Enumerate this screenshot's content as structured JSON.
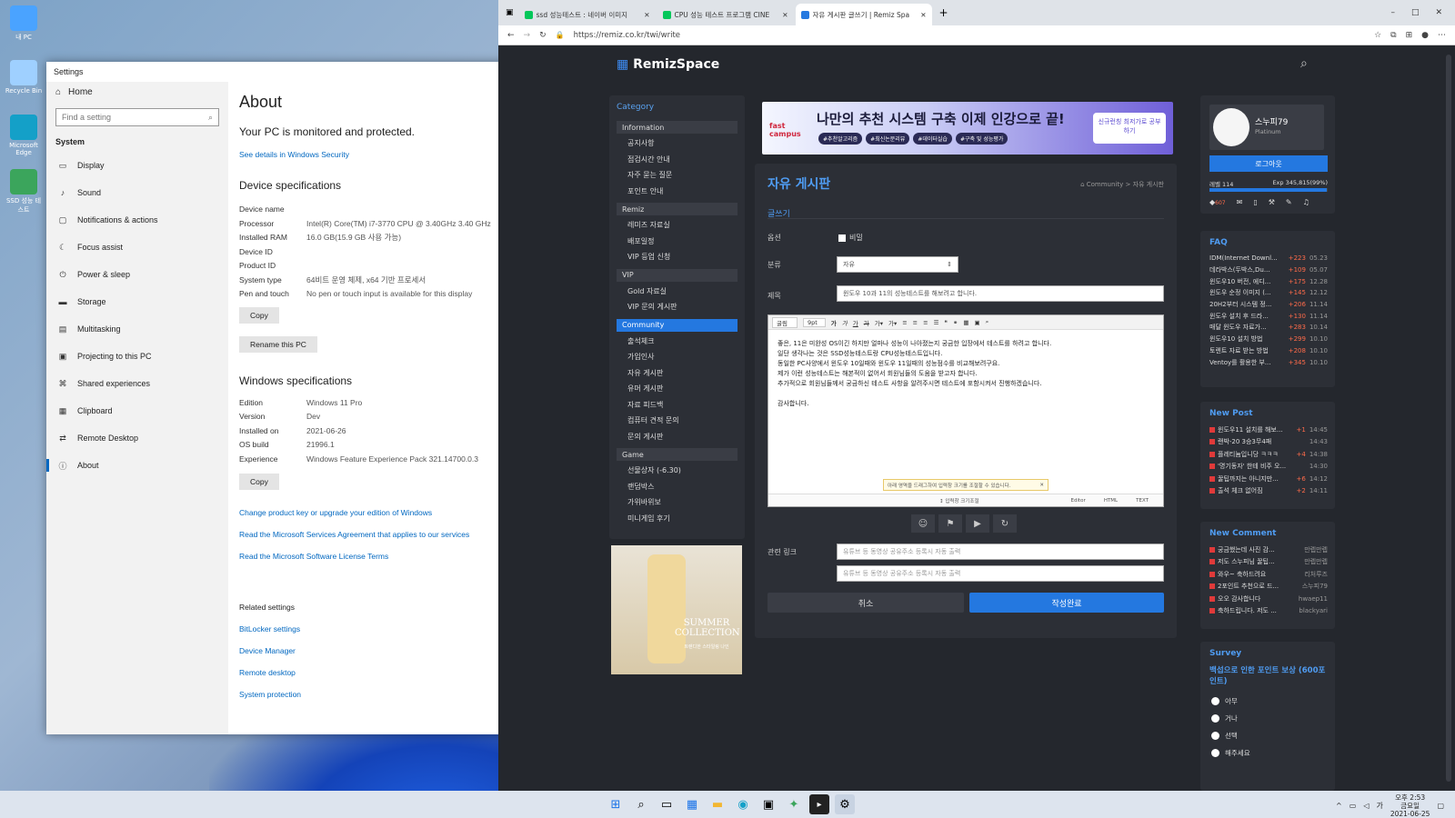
{
  "desktop": {
    "icons": [
      {
        "label": "내 PC",
        "color": "#4aa3ff"
      },
      {
        "label": "Recycle Bin",
        "color": "#9fd0ff"
      },
      {
        "label": "Microsoft Edge",
        "color": "#14a0c8"
      },
      {
        "label": "SSD 성능 테스트",
        "color": "#3ba55c"
      }
    ]
  },
  "settings": {
    "window_title": "Settings",
    "home": "Home",
    "search_placeholder": "Find a setting",
    "section": "System",
    "nav": [
      {
        "label": "Display",
        "icon": "▭"
      },
      {
        "label": "Sound",
        "icon": "♪"
      },
      {
        "label": "Notifications & actions",
        "icon": "▢"
      },
      {
        "label": "Focus assist",
        "icon": "☾"
      },
      {
        "label": "Power & sleep",
        "icon": "⏻"
      },
      {
        "label": "Storage",
        "icon": "▬"
      },
      {
        "label": "Multitasking",
        "icon": "▤"
      },
      {
        "label": "Projecting to this PC",
        "icon": "▣"
      },
      {
        "label": "Shared experiences",
        "icon": "⌘"
      },
      {
        "label": "Clipboard",
        "icon": "▦"
      },
      {
        "label": "Remote Desktop",
        "icon": "⇄"
      },
      {
        "label": "About",
        "icon": "ⓘ"
      }
    ],
    "about_title": "About",
    "protected": "Your PC is monitored and protected.",
    "security_link": "See details in Windows Security",
    "device_heading": "Device specifications",
    "device": [
      {
        "k": "Device name",
        "v": ""
      },
      {
        "k": "Processor",
        "v": "Intel(R) Core(TM) i7-3770 CPU @ 3.40GHz   3.40 GHz"
      },
      {
        "k": "Installed RAM",
        "v": "16.0 GB(15.9 GB 사용 가능)"
      },
      {
        "k": "Device ID",
        "v": ""
      },
      {
        "k": "Product ID",
        "v": ""
      },
      {
        "k": "System type",
        "v": "64비트 운영 체제, x64 기반 프로세서"
      },
      {
        "k": "Pen and touch",
        "v": "No pen or touch input is available for this display"
      }
    ],
    "copy_label": "Copy",
    "rename_label": "Rename this PC",
    "windows_heading": "Windows specifications",
    "windows": [
      {
        "k": "Edition",
        "v": "Windows 11 Pro"
      },
      {
        "k": "Version",
        "v": "Dev"
      },
      {
        "k": "Installed on",
        "v": "2021-06-26"
      },
      {
        "k": "OS build",
        "v": "21996.1"
      },
      {
        "k": "Experience",
        "v": "Windows Feature Experience Pack 321.14700.0.3"
      }
    ],
    "links": [
      "Change product key or upgrade your edition of Windows",
      "Read the Microsoft Services Agreement that applies to our services",
      "Read the Microsoft Software License Terms"
    ],
    "related_heading": "Related settings",
    "related": [
      "BitLocker settings",
      "Device Manager",
      "Remote desktop",
      "System protection"
    ]
  },
  "browser": {
    "tabs": [
      {
        "title": "ssd 성능테스트 : 네이버 이미지",
        "color": "#03c75a"
      },
      {
        "title": "CPU 성능 테스트 프로그램 CINE",
        "color": "#03c75a"
      },
      {
        "title": "자유 게시판 글쓰기 | Remiz Spa",
        "color": "#2478e0"
      }
    ],
    "url": "https://remiz.co.kr/twi/write"
  },
  "site": {
    "logo": "RemizSpace",
    "category_title": "Category",
    "sections": [
      {
        "title": "Information",
        "items": [
          "공지사항",
          "점검시간 안내",
          "자주 묻는 질문",
          "포인트 안내"
        ]
      },
      {
        "title": "Remiz",
        "items": [
          "레미즈 자료실",
          "배포일정",
          "VIP 등업 신청"
        ]
      },
      {
        "title": "VIP",
        "items": [
          "Gold 자료실",
          "VIP 문의 게시판"
        ]
      },
      {
        "title": "Community",
        "items": [
          "출석체크",
          "가입인사",
          "자유 게시판",
          "유머 게시판",
          "자료 피드백",
          "컴퓨터 견적 문의",
          "문의 게시판"
        ]
      },
      {
        "title": "Game",
        "items": [
          "선물상자 (-6.30)",
          "랜덤박스",
          "가위바위보",
          "미니게임 후기"
        ]
      }
    ],
    "ad_text": "나만의 추천 시스템 구축 이제 인강으로 끝!",
    "ad_brand": "fast campus",
    "ad_tags": [
      "#추천알고리즘",
      "#최신논문리뷰",
      "#데이터실습",
      "#구축 및 성능평가"
    ],
    "ad_cta": "신규런칭 최저가로 공부하기",
    "ad2_text": "SUMMER COLLECTION",
    "ad2_sub": "트렌디한 스타일링 나인",
    "board_title": "자유 게시판",
    "breadcrumb": "Community > 자유 게시판",
    "write_label": "글쓰기",
    "option_label": "옵션",
    "secret_label": "비밀",
    "category_label": "분류",
    "category_value": "자유",
    "subject_label": "제목",
    "subject_value": "윈도우 10과 11의 성능테스트를 해보려고 합니다.",
    "editor_font": "굴림",
    "editor_size": "9pt",
    "body": [
      "좋은, 11은 미완성 OS이긴 하지만 얼마나 성능이 나아졌는지 궁금한 입장에서 테스트를 하려고 합니다.",
      "일단 생각나는 것은 SSD성능테스트랑 CPU성능테스트입니다.",
      "동일한 PC사양에서 윈도우 10일때와 윈도우 11일때의 성능점수를 비교해보려구요.",
      "제가 이런 성능테스트는 해본적이 없어서 회원님들의 도움을 받고자 합니다.",
      "추가적으로 회원님들께서 궁금하신 테스트 사항을 알려주시면 테스트에 포함시켜서 진행하겠습니다.",
      "",
      "감사합니다."
    ],
    "editor_hint": "아래 영역을 드래그하여 입력창 크기를 조절할 수 있습니다.",
    "editor_resize": "↕ 입력창 크기조절",
    "editor_modes": [
      "Editor",
      "HTML",
      "TEXT"
    ],
    "related_label": "관련 링크",
    "link_placeholder": "유튜브 등 동영상 공유주소 등록시 자동 출력",
    "cancel_label": "취소",
    "submit_label": "작성완료",
    "user": {
      "name": "스누피79",
      "grade": "Platinum",
      "login": "로그아웃",
      "level": "레벨 114",
      "exp": "Exp 345,815(99%)",
      "exp_fraction": 0.99,
      "points": "607"
    },
    "faq_title": "FAQ",
    "faq": [
      {
        "t": "IDM(Internet Downl...",
        "c": "+223",
        "d": "05.23"
      },
      {
        "t": "데라박스(두박스,Du...",
        "c": "+109",
        "d": "05.07"
      },
      {
        "t": "윈도우10 버전, 에디...",
        "c": "+175",
        "d": "12.28"
      },
      {
        "t": "윈도우 순정 이미지 (...",
        "c": "+145",
        "d": "12.12"
      },
      {
        "t": "20H2부터 시스템 정...",
        "c": "+206",
        "d": "11.14"
      },
      {
        "t": "윈도우 설치 후 드라...",
        "c": "+130",
        "d": "11.14"
      },
      {
        "t": "매달 윈도우 자료가...",
        "c": "+283",
        "d": "10.14"
      },
      {
        "t": "윈도우10 설치 방법",
        "c": "+299",
        "d": "10.10"
      },
      {
        "t": "토렌트 자료 받는 방법",
        "c": "+208",
        "d": "10.10"
      },
      {
        "t": "Ventoy를 활용한 부...",
        "c": "+345",
        "d": "10.10"
      }
    ],
    "newpost_title": "New Post",
    "newposts": [
      {
        "t": "윈도우11 설치를 해보...",
        "r": "+1",
        "d": "14:45"
      },
      {
        "t": "랜박-20 3승3무4패",
        "r": "",
        "d": "14:43"
      },
      {
        "t": "플레티늄입니당 ㅋㅋㅋ",
        "r": "+4",
        "d": "14:38"
      },
      {
        "t": "'명기동자' 한테 비주 오...",
        "r": "",
        "d": "14:30"
      },
      {
        "t": "꿀팁까지는 아니지만...",
        "r": "+6",
        "d": "14:12"
      },
      {
        "t": "출석 체크 없어짐",
        "r": "+2",
        "d": "14:11"
      }
    ],
    "newcomment_title": "New Comment",
    "newcomments": [
      {
        "t": "궁금했는데 사진 감...",
        "d": "만렙만렙"
      },
      {
        "t": "저도 스누피님 꿀팁...",
        "d": "만렙만렙"
      },
      {
        "t": "와우~ 축하드려요",
        "d": "리처루즈"
      },
      {
        "t": "2포인트 추천으로 드...",
        "d": "스누피79"
      },
      {
        "t": "오오 감사합니다",
        "d": "hwaep11"
      },
      {
        "t": "축하드립니다. 저도 ...",
        "d": "blackyari"
      }
    ],
    "survey_title": "Survey",
    "survey_question": "백섭으로 인한 포인트 보상 (600포인트)",
    "survey_options": [
      "아무",
      "거나",
      "선택",
      "해주세요"
    ]
  },
  "taskbar": {
    "time": "오후 2:53",
    "day": "금요일",
    "date": "2021-06-25"
  }
}
